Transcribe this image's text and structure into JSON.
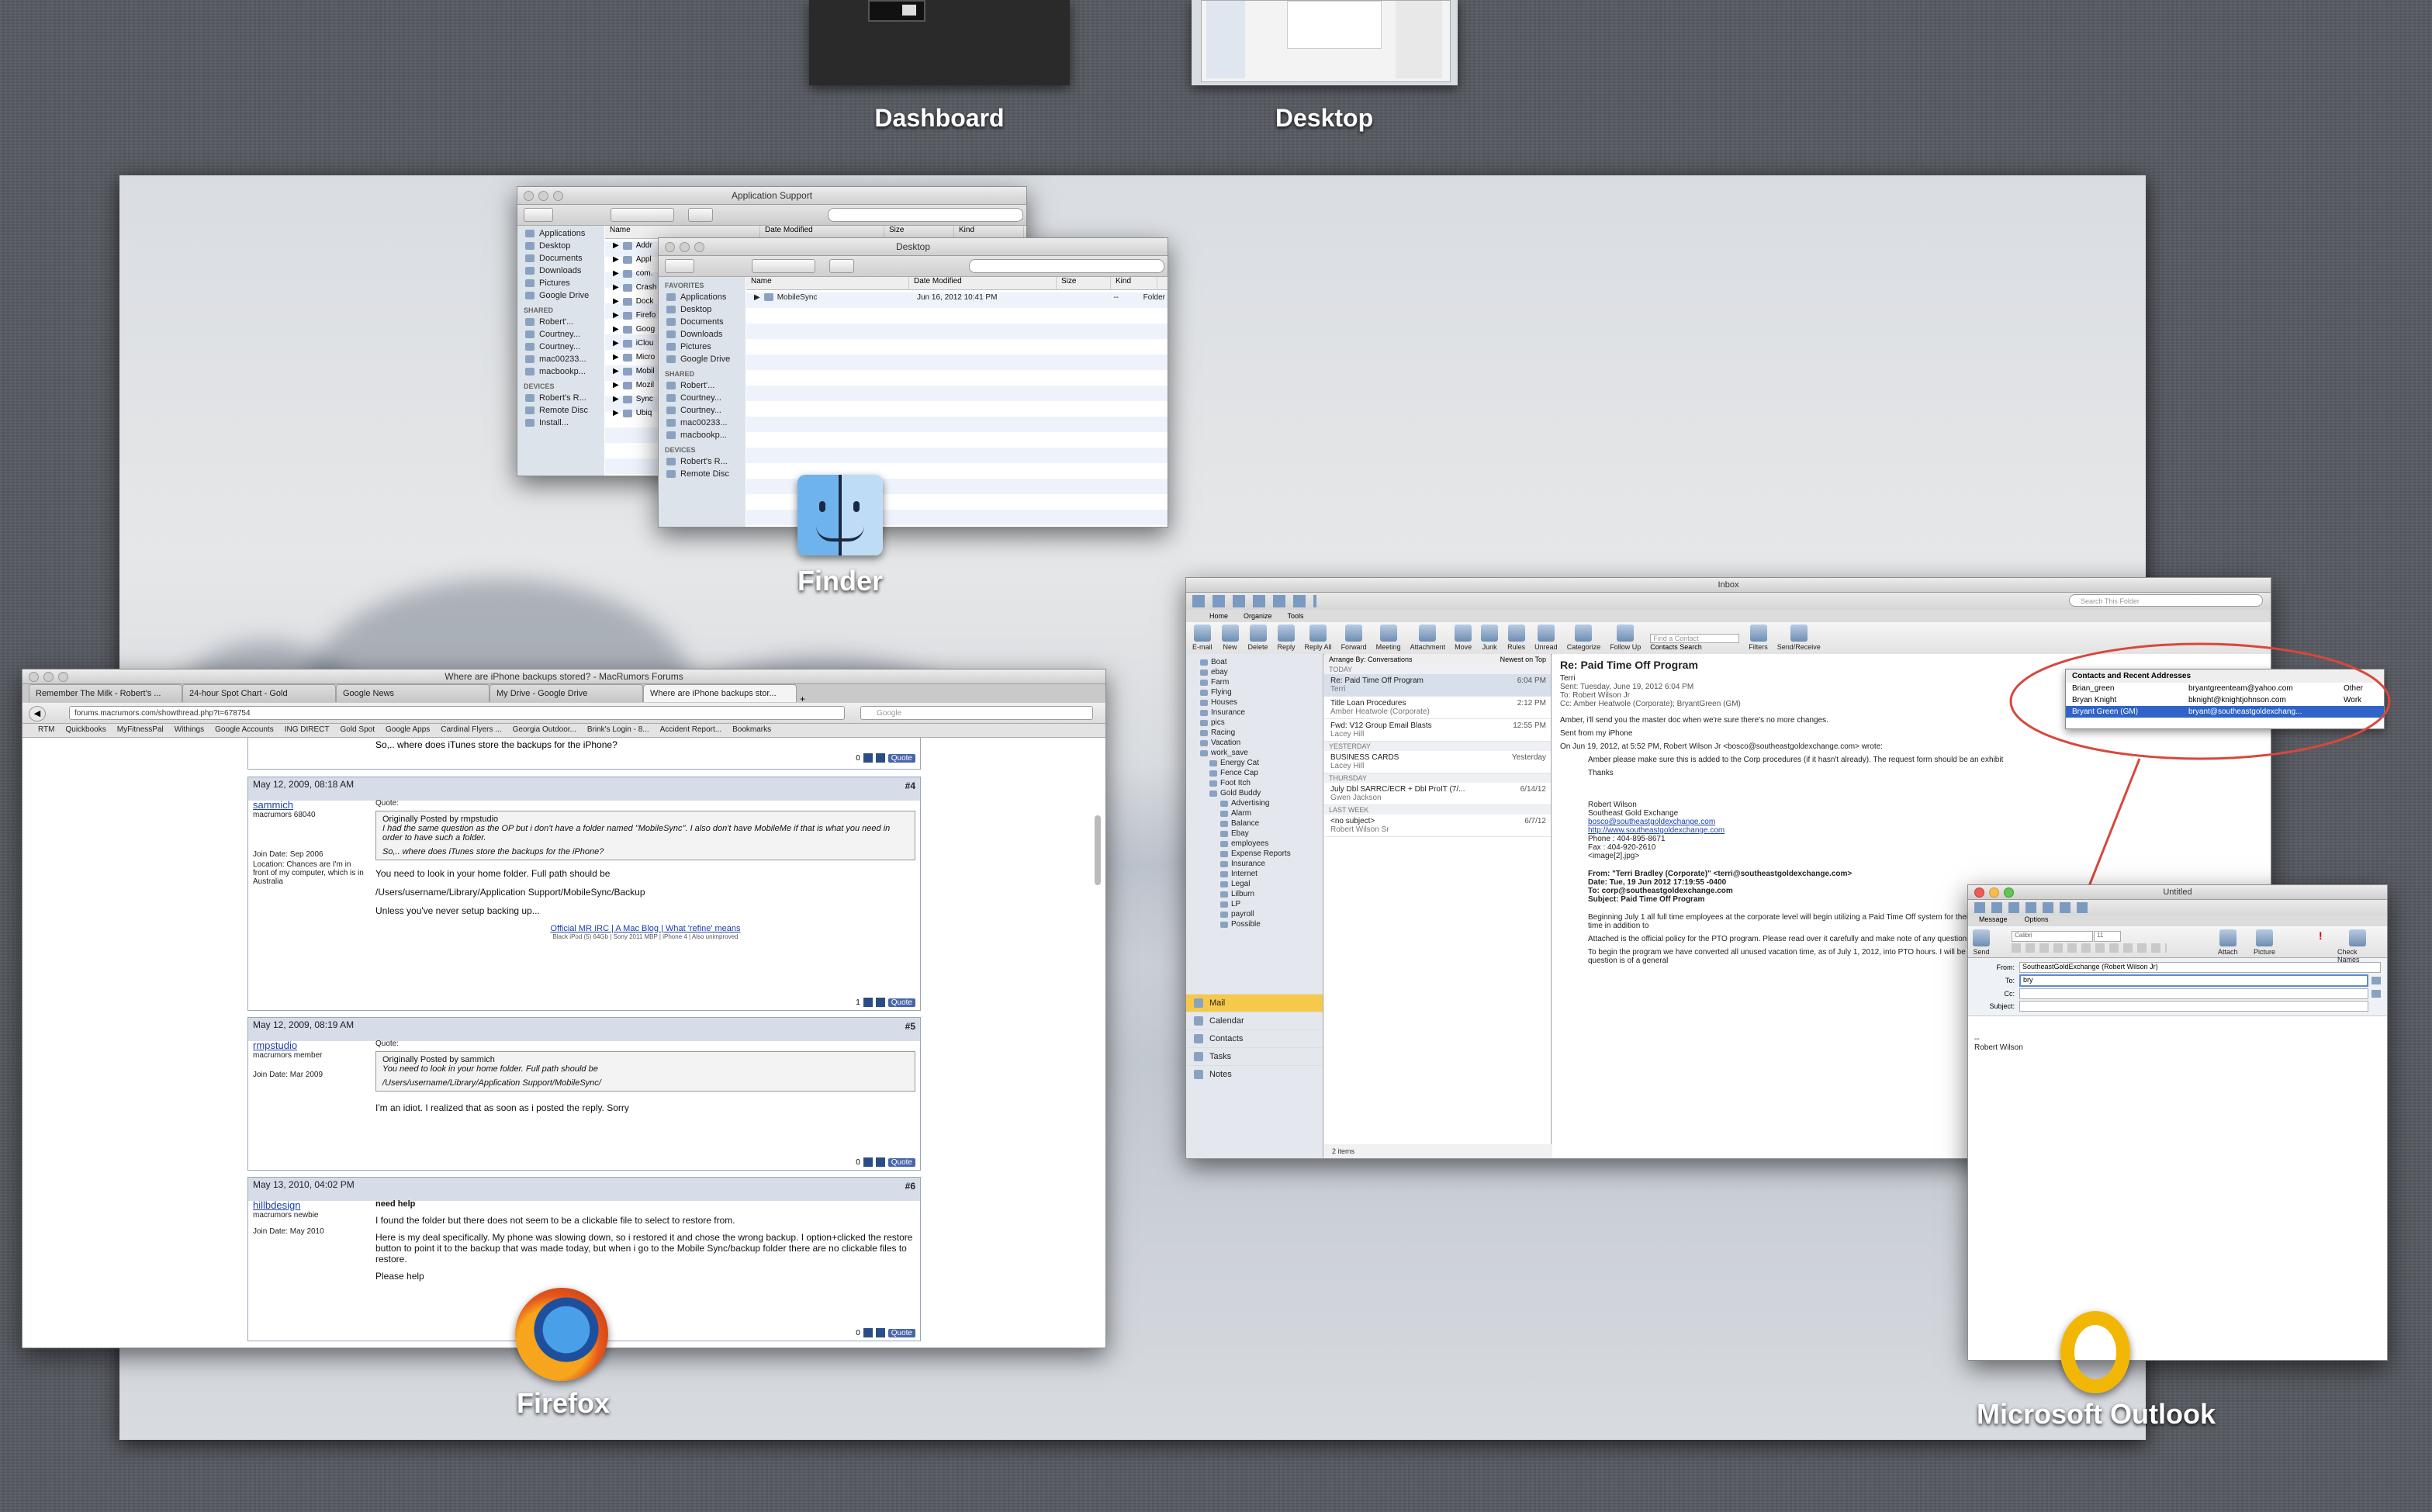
{
  "spaces": {
    "dashboard_label": "Dashboard",
    "desktop_label": "Desktop"
  },
  "finder": {
    "app_label": "Finder",
    "window_back_title": "Application Support",
    "window_front_title": "Desktop",
    "back_columns": [
      "Name",
      "Date Modified",
      "Size",
      "Kind"
    ],
    "back_sidebar": [
      "Applications",
      "Desktop",
      "Documents",
      "Downloads",
      "Pictures",
      "Google Drive"
    ],
    "back_shared": [
      "Robert'...",
      "Courtney...",
      "Courtney...",
      "mac00233...",
      "macbookp..."
    ],
    "back_devices": [
      "Robert's R...",
      "Remote Disc",
      "Install..."
    ],
    "back_files": [
      "Addr",
      "Appl",
      "com.",
      "Crash",
      "Dock",
      "Firefo",
      "Goog",
      "iClou",
      "Micro",
      "Mobil",
      "Mozil",
      "Sync",
      "Ubiq"
    ],
    "front_favorites_head": "FAVORITES",
    "front_sidebar": [
      "Applications",
      "Desktop",
      "Documents",
      "Downloads",
      "Pictures",
      "Google Drive"
    ],
    "front_shared_head": "SHARED",
    "front_shared": [
      "Robert'...",
      "Courtney...",
      "Courtney...",
      "mac00233...",
      "macbookp..."
    ],
    "front_devices_head": "DEVICES",
    "front_devices": [
      "Robert's R...",
      "Remote Disc"
    ],
    "front_columns": [
      "Name",
      "Date Modified",
      "Size",
      "Kind"
    ],
    "front_file": {
      "name": "MobileSync",
      "date": "Jun 16, 2012 10:41 PM",
      "size": "--",
      "kind": "Folder"
    }
  },
  "firefox": {
    "app_label": "Firefox",
    "window_title": "Where are iPhone backups stored? - MacRumors Forums",
    "tabs": [
      "Remember The Milk - Robert's ...",
      "24-hour Spot Chart - Gold",
      "Google News",
      "My Drive - Google Drive",
      "Where are iPhone backups stor..."
    ],
    "url": "forums.macrumors.com/showthread.php?t=678754",
    "search_placeholder": "Google",
    "bookmarks": [
      "RTM",
      "Quickbooks",
      "MyFitnessPal",
      "Withings",
      "Google Accounts",
      "ING DIRECT",
      "Gold Spot",
      "Google Apps",
      "Cardinal Flyers ...",
      "Georgia Outdoor...",
      "Brink's Login - 8...",
      "Accident Report...",
      "Bookmarks"
    ],
    "top_snippet": "So,.. where does iTunes store the backups for the iPhone?",
    "vote_count_top": "0",
    "quote_label": "Quote",
    "posts": [
      {
        "date": "May 12, 2009, 08:18 AM",
        "number": "#4",
        "user": "sammich",
        "user_meta": "macrumors 68040",
        "join": "Join Date: Sep 2006",
        "location": "Location: Chances are I'm in front of my computer, which is in Australia",
        "quote_head": "Quote:",
        "quote_by": "Originally Posted by rmpstudio",
        "quote_text": "I had the same question as the OP but i don't have a folder named \"MobileSync\". I also don't have MobileMe if that is what you need in order to have such a folder.",
        "quote_text2": "So,.. where does iTunes store the backups for the iPhone?",
        "body1": "You need to look in your home folder. Full path should be",
        "body2": "/Users/username/Library/Application Support/MobileSync/Backup",
        "body3": "Unless you've never setup backing up...",
        "sig": "Official MR IRC | A Mac Blog | What 'refine' means",
        "sig2": "Black iPod (5) 64Gb | Sony 2011 MBP | iPhone 4 | Also unimproved",
        "votes": "1"
      },
      {
        "date": "May 12, 2009, 08:19 AM",
        "number": "#5",
        "user": "rmpstudio",
        "user_meta": "macrumors member",
        "join": "Join Date: Mar 2009",
        "quote_head": "Quote:",
        "quote_by": "Originally Posted by sammich",
        "quote_text": "You need to look in your home folder. Full path should be",
        "quote_text2": "/Users/username/Library/Application Support/MobileSync/",
        "body1": "I'm an idiot. I realized that as soon as i posted the reply. Sorry",
        "votes": "0"
      },
      {
        "date": "May 13, 2010, 04:02 PM",
        "number": "#6",
        "user": "hillbdesign",
        "user_meta": "macrumors newbie",
        "join": "Join Date: May 2010",
        "title": "need help",
        "body1": "I found the folder but there does not seem to be a clickable file to select to restore from.",
        "body2": "Here is my deal specifically. My phone was slowing down, so i restored it and chose the wrong backup. I option+clicked the restore button to point it to the backup that was made today, but when i go to the Mobile Sync/backup folder there are no clickable files to restore.",
        "body3": "Please help",
        "votes": "0"
      }
    ]
  },
  "outlook_main": {
    "window_title": "Inbox",
    "search_placeholder": "Search This Folder",
    "ribbon_tabs": [
      "Home",
      "Organize",
      "Tools"
    ],
    "ribbon_buttons": [
      "E-mail",
      "New",
      "Delete",
      "Reply",
      "Reply All",
      "Forward",
      "Meeting",
      "Attachment",
      "Move",
      "Junk",
      "Rules",
      "Unread",
      "Categorize",
      "Follow Up",
      "Filters",
      "Send/Receive"
    ],
    "find_contact": "Find a Contact",
    "contacts_search": "Contacts Search",
    "arrange_by": "Arrange By: Conversations",
    "sort": "Newest on Top",
    "folders": [
      "Boat",
      "ebay",
      "Farm",
      "Flying",
      "Houses",
      "Insurance",
      "pics",
      "Racing",
      "Vacation",
      "work_save",
      "Energy Cat",
      "Fence Cap",
      "Foot Itch",
      "Gold Buddy",
      "Advertising",
      "Alarm",
      "Balance",
      "Ebay",
      "employees",
      "Expense Reports",
      "Insurance",
      "Internet",
      "Legal",
      "Lilburn",
      "LP",
      "payroll",
      "Possible"
    ],
    "nav": [
      "Mail",
      "Calendar",
      "Contacts",
      "Tasks",
      "Notes"
    ],
    "groups": {
      "today": "TODAY",
      "yesterday": "YESTERDAY",
      "thursday": "THURSDAY",
      "last_week": "LAST WEEK"
    },
    "messages": [
      {
        "subject": "Re: Paid Time Off Program",
        "from": "Terri",
        "date": "6:04 PM"
      },
      {
        "subject": "Title Loan Procedures",
        "from": "Amber Heatwole (Corporate)",
        "date": "2:12 PM"
      },
      {
        "subject": "Fwd: V12 Group Email Blasts",
        "from": "Lacey Hill",
        "date": "12:55 PM"
      },
      {
        "subject": "BUSINESS CARDS",
        "from": "Lacey Hill",
        "date": "Yesterday"
      },
      {
        "subject": "July Dbl SARRC/ECR + Dbl ProIT (7/...",
        "from": "Gwen Jackson",
        "date": "6/14/12"
      },
      {
        "subject": "<no subject>",
        "from": "Robert Wilson Sr",
        "date": "6/7/12"
      }
    ],
    "items_count": "2 items",
    "reading": {
      "subject": "Re: Paid Time Off Program",
      "from": "Terri",
      "sent": "Sent: Tuesday, June 19, 2012 6:04 PM",
      "to": "To: Robert Wilson Jr",
      "cc": "Cc: Amber Heatwole (Corporate); BryantGreen (GM)",
      "line1": "Amber, i'll send you the master doc when we're sure there's no more changes.",
      "line2": "Sent from my iPhone",
      "line3": "On Jun 19, 2012, at 5:52 PM, Robert Wilson Jr <bosco@southeastgoldexchange.com> wrote:",
      "line4": "Amber please make sure this is added to the Corp procedures (if it hasn't already). The request form should be an exhibit",
      "line5": "Thanks",
      "sig_name": "Robert Wilson",
      "sig_company": "Southeast Gold Exchange",
      "sig_email": "bosco@southeastgoldexchange.com",
      "sig_web": "http://www.southeastgoldexchange.com",
      "sig_phone": "Phone : 404-895-8671",
      "sig_fax": "Fax : 404-920-2610",
      "sig_img": "<image[2].jpg>",
      "fwd_from": "From: \"Terri Bradley (Corporate)\" <terri@southeastgoldexchange.com>",
      "fwd_date": "Date: Tue, 19 Jun 2012 17:19:55 -0400",
      "fwd_to": "To: corp@southeastgoldexchange.com",
      "fwd_subject": "Subject: Paid Time Off Program",
      "para1": "Beginning July 1 all full time employees at the corporate level will begin utilizing a Paid Time Off system for their vacation time monthly, rather than annually, and allots time for sick and personal time in addition to",
      "para2": "Attached is the official policy for the PTO program. Please read over it carefully and make note of any questions at the end of the daily conference call. This meeting is mandatory.",
      "para3": "To begin the program we have converted all unused vacation time, as of July 1, 2012, into PTO hours. I will be meeting. If you have any questions about this balance or how it was derived, and the question is of a general"
    },
    "contacts_popup": {
      "title": "Contacts and Recent Addresses",
      "rows": [
        {
          "name": "Brian_green",
          "email": "bryantgreenteam@yahoo.com",
          "type": "Other"
        },
        {
          "name": "Bryan Knight",
          "email": "bknight@knightjohnson.com",
          "type": "Work"
        },
        {
          "name": "Bryant Green (GM)",
          "email": "bryant@southeastgoldexchang...",
          "type": ""
        }
      ]
    }
  },
  "outlook_compose": {
    "window_title": "Untitled",
    "tabs": [
      "Message",
      "Options"
    ],
    "font": "Calibri",
    "font_size": "11",
    "buttons": [
      "Send",
      "Attach",
      "Picture",
      "Check Names"
    ],
    "from_label": "From:",
    "from_value": "SoutheastGoldExchange (Robert Wilson Jr)",
    "to_label": "To:",
    "to_value": "bry",
    "cc_label": "Cc:",
    "subject_label": "Subject:",
    "body_sep": "--",
    "body_name": "Robert Wilson"
  },
  "outlook": {
    "app_label": "Microsoft Outlook"
  },
  "colors": {
    "background": "#575a61",
    "annotation_red": "#d9473b",
    "outlook_gold": "#f2b705",
    "link_blue": "#1a3ea8"
  }
}
